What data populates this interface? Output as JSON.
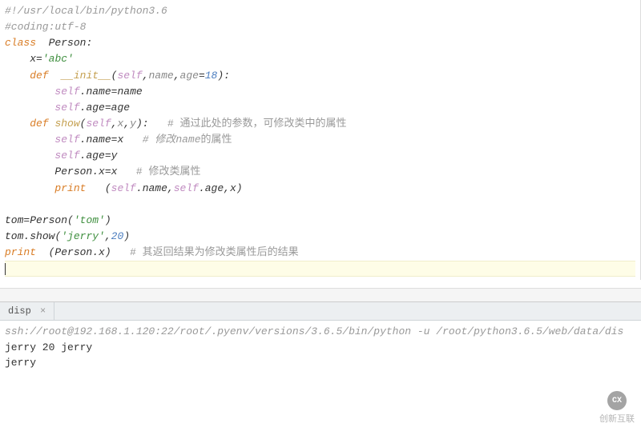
{
  "code": {
    "l1": "#!/usr/local/bin/python3.6",
    "l2": "#coding:utf-8",
    "kw_class": "class",
    "cls": "Person",
    "x_attr": "x=",
    "x_val": "'abc'",
    "kw_def": "def",
    "fn_init": "__init__",
    "init_params_open": "(",
    "p_self": "self",
    "p_name": "name",
    "p_age": "age",
    "eq": "=",
    "n18": "18",
    "close_colon": "):",
    "assign_name": "self.name=name",
    "assign_age": "self.age=age",
    "fn_show": "show",
    "p_x": "x",
    "p_y": "y",
    "comment_show": "# 通过此处的参数，可修改类中的属性",
    "show_body_name": "self.name=x",
    "comment_name": "# 修改",
    "comment_name_i": "name",
    "comment_name_tail": "的属性",
    "show_body_age": "self.age=y",
    "person_x": "Person.x=x",
    "comment_cls": "# 修改类属性",
    "kw_print": "print",
    "print_args": "   (self.name,self.age,x)",
    "tom_new_a": "tom=Person(",
    "tom_str": "'tom'",
    "tom_new_b": ")",
    "tom_show_a": "tom.show(",
    "jerry_str": "'jerry'",
    "comma": ",",
    "n20": "20",
    "tom_show_b": ")",
    "print_px": "  (Person.x)",
    "comment_res": "# 其返回结果为修改类属性后的结果"
  },
  "tab": {
    "label": "disp",
    "close": "×"
  },
  "console": {
    "ssh": "ssh://root@192.168.1.120:22/root/.pyenv/versions/3.6.5/bin/python -u /root/python3.6.5/web/data/dis",
    "out1": "jerry 20 jerry",
    "out2": "jerry"
  },
  "watermark": {
    "logo_text": "CX",
    "text": "创新互联"
  }
}
